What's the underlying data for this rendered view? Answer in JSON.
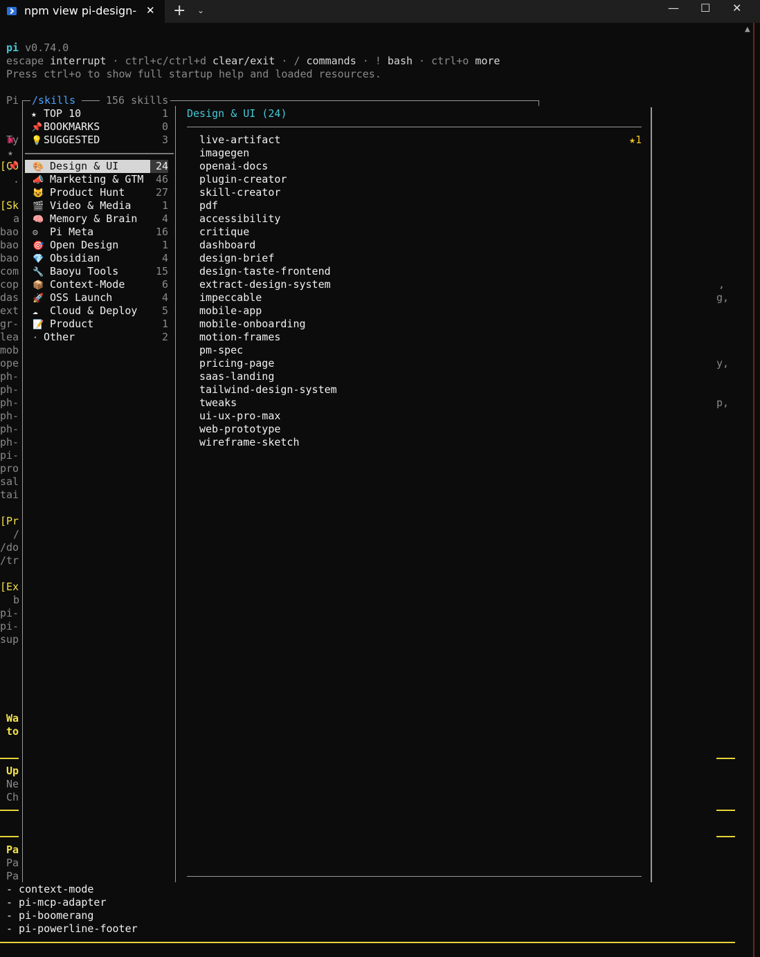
{
  "window": {
    "tab_title": "npm view pi-design-",
    "tab_close": "✕",
    "new_tab": "+",
    "dropdown": "⌄",
    "minimize": "—",
    "maximize": "☐",
    "close": "✕"
  },
  "header": {
    "app": "pi",
    "version": "v0.74.0",
    "keys": [
      {
        "key": "escape",
        "action": "interrupt"
      },
      {
        "key": "ctrl+c/ctrl+d",
        "action": "clear/exit"
      },
      {
        "key": "/",
        "action": "commands"
      },
      {
        "key": "!",
        "action": "bash"
      },
      {
        "key": "ctrl+o",
        "action": "more"
      }
    ],
    "sep": " · ",
    "startup_help": "Press ctrl+o to show full startup help and loaded resources."
  },
  "panel": {
    "prefix": "Pi",
    "title": "/skills",
    "count_label": "156 skills"
  },
  "sidebar": {
    "pinned": [
      {
        "icon": "star-icon",
        "glyph": "★",
        "label": "TOP 10",
        "count": "1"
      },
      {
        "icon": "pushpin-icon",
        "glyph": "📌",
        "label": "BOOKMARKS",
        "count": "0"
      },
      {
        "icon": "lightbulb-icon",
        "glyph": "💡",
        "label": "SUGGESTED",
        "count": "3"
      }
    ],
    "categories": [
      {
        "icon": "palette-icon",
        "glyph": "🎨",
        "label": "Design & UI",
        "count": "24",
        "selected": true
      },
      {
        "icon": "megaphone-icon",
        "glyph": "📣",
        "label": "Marketing & GTM",
        "count": "46"
      },
      {
        "icon": "cat-icon",
        "glyph": "😺",
        "label": "Product Hunt",
        "count": "27"
      },
      {
        "icon": "clapper-icon",
        "glyph": "🎬",
        "label": "Video & Media",
        "count": "1"
      },
      {
        "icon": "brain-icon",
        "glyph": "🧠",
        "label": "Memory & Brain",
        "count": "4"
      },
      {
        "icon": "gear-icon",
        "glyph": "⚙",
        "label": "Pi Meta",
        "count": "16"
      },
      {
        "icon": "target-icon",
        "glyph": "🎯",
        "label": "Open Design",
        "count": "1"
      },
      {
        "icon": "gem-icon",
        "glyph": "💎",
        "label": "Obsidian",
        "count": "4"
      },
      {
        "icon": "wrench-icon",
        "glyph": "🔧",
        "label": "Baoyu Tools",
        "count": "15"
      },
      {
        "icon": "package-icon",
        "glyph": "📦",
        "label": "Context-Mode",
        "count": "6"
      },
      {
        "icon": "rocket-icon",
        "glyph": "🚀",
        "label": "OSS Launch",
        "count": "4"
      },
      {
        "icon": "cloud-icon",
        "glyph": "☁",
        "label": "Cloud & Deploy",
        "count": "5"
      },
      {
        "icon": "memo-icon",
        "glyph": "📝",
        "label": "Product",
        "count": "1"
      },
      {
        "icon": "dot-icon",
        "glyph": "·",
        "label": "Other",
        "count": "2"
      }
    ]
  },
  "detail": {
    "title": "Design & UI (24)",
    "skills": [
      "live-artifact",
      "imagegen",
      "openai-docs",
      "plugin-creator",
      "skill-creator",
      "pdf",
      "accessibility",
      "critique",
      "dashboard",
      "design-brief",
      "design-taste-frontend",
      "extract-design-system",
      "impeccable",
      "mobile-app",
      "mobile-onboarding",
      "motion-frames",
      "pm-spec",
      "pricing-page",
      "saas-landing",
      "tailwind-design-system",
      "tweaks",
      "ui-ux-pro-max",
      "web-prototype",
      "wireframe-sketch"
    ],
    "first_badge": "★1"
  },
  "background_left": {
    "rows_a": [
      "",
      "",
      "",
      "Ty",
      "",
      "[Co",
      ".",
      "",
      "[Sk",
      "a",
      "bao",
      "bao",
      "bao",
      "com",
      "cop",
      "das",
      "ext",
      "gr-",
      "lea",
      "mob",
      "ope",
      "ph-",
      "ph-",
      "ph-",
      "ph-",
      "ph-",
      "ph-",
      "pi-",
      "pro",
      "sal",
      "tai",
      "",
      "[Pr",
      "/",
      "/do",
      "/tr",
      "",
      "[Ex",
      "b",
      "pi-",
      "pi-",
      "sup"
    ],
    "wa": "Wa",
    "to": "to",
    "up": "Up",
    "ne": "Ne",
    "ch": "Ch",
    "pa1": "Pa",
    "pa2": "Pa",
    "pa3": "Pa"
  },
  "background_right": {
    "r1": ",",
    "r2": "g,",
    "r3": "y,",
    "r4": "p,"
  },
  "bottom_list": [
    "- context-mode",
    "- pi-mcp-adapter",
    "- pi-boomerang",
    "- pi-powerline-footer"
  ]
}
